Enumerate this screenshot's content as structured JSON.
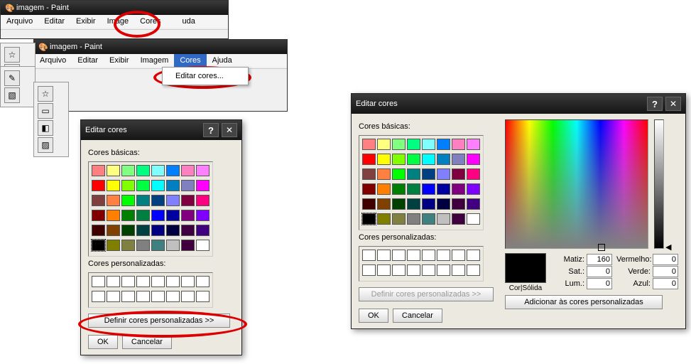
{
  "app": {
    "title": "imagem - Paint"
  },
  "menu": {
    "arquivo": "Arquivo",
    "editar": "Editar",
    "exibir": "Exibir",
    "imagem": "Imagem",
    "cores": "Cores",
    "ajuda": "Ajuda"
  },
  "menuTrunc": "uda",
  "menuTruncImg": "Image",
  "dropdown": {
    "editar_cores": "Editar cores..."
  },
  "dlg": {
    "title": "Editar cores",
    "basic": "Cores básicas:",
    "custom": "Cores personalizadas:",
    "define": "Definir cores personalizadas >>",
    "ok": "OK",
    "cancel": "Cancelar",
    "add": "Adicionar às cores personalizadas",
    "corSolida": "Cor|Sólida",
    "matiz": "Matiz:",
    "sat": "Sat.:",
    "lum": "Lum.:",
    "verm": "Vermelho:",
    "verde": "Verde:",
    "azul": "Azul:"
  },
  "vals": {
    "matiz": "160",
    "sat": "0",
    "lum": "0",
    "r": "0",
    "g": "0",
    "b": "0"
  },
  "basicColors": [
    [
      "#ff8080",
      "#ffff80",
      "#80ff80",
      "#00ff80",
      "#80ffff",
      "#0080ff",
      "#ff80c0",
      "#ff80ff"
    ],
    [
      "#ff0000",
      "#ffff00",
      "#80ff00",
      "#00ff40",
      "#00ffff",
      "#0080c0",
      "#8080c0",
      "#ff00ff"
    ],
    [
      "#804040",
      "#ff8040",
      "#00ff00",
      "#008080",
      "#004080",
      "#8080ff",
      "#800040",
      "#ff0080"
    ],
    [
      "#800000",
      "#ff8000",
      "#008000",
      "#008040",
      "#0000ff",
      "#0000a0",
      "#800080",
      "#8000ff"
    ],
    [
      "#400000",
      "#804000",
      "#004000",
      "#004040",
      "#000080",
      "#000040",
      "#400040",
      "#400080"
    ],
    [
      "#000000",
      "#808000",
      "#808040",
      "#808080",
      "#408080",
      "#c0c0c0",
      "#400040",
      "#ffffff"
    ]
  ]
}
